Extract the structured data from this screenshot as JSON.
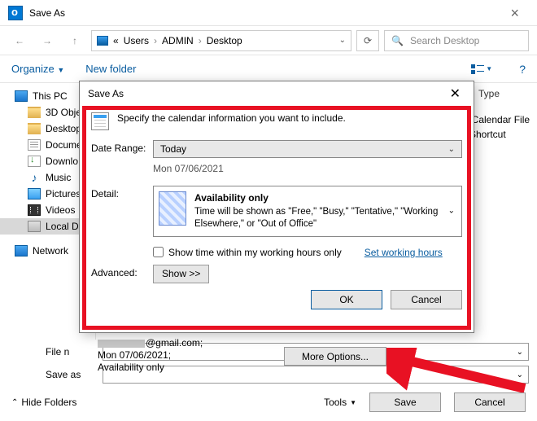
{
  "titlebar": {
    "title": "Save As"
  },
  "nav": {
    "path": [
      "Users",
      "ADMIN",
      "Desktop"
    ],
    "search_placeholder": "Search Desktop"
  },
  "toolbar": {
    "organize": "Organize",
    "newfolder": "New folder"
  },
  "columns": {
    "type": "Type"
  },
  "tree": {
    "thispc": "This PC",
    "items": [
      {
        "label": "3D Obje"
      },
      {
        "label": "Desktop"
      },
      {
        "label": "Docume"
      },
      {
        "label": "Downlo"
      },
      {
        "label": "Music"
      },
      {
        "label": "Pictures"
      },
      {
        "label": "Videos"
      },
      {
        "label": "Local D"
      }
    ],
    "network": "Network"
  },
  "filelist": {
    "rows": [
      {
        "type": "iCalendar File"
      },
      {
        "type": "Shortcut"
      }
    ]
  },
  "bottom": {
    "filename_label": "File n",
    "saveas_label": "Save as"
  },
  "preview": {
    "line1": "@gmail.com;",
    "line2": "Mon 07/06/2021;",
    "line3": "Availability only"
  },
  "moreoptions": "More Options...",
  "footer": {
    "hide": "Hide Folders",
    "tools": "Tools",
    "save": "Save",
    "cancel": "Cancel"
  },
  "dialog": {
    "title": "Save As",
    "intro": "Specify the calendar information you want to include.",
    "daterange_label": "Date Range:",
    "daterange_value": "Today",
    "daterange_sub": "Mon 07/06/2021",
    "detail_label": "Detail:",
    "detail_title": "Availability only",
    "detail_desc": "Time will be shown as \"Free,\" \"Busy,\" \"Tentative,\" \"Working Elsewhere,\" or \"Out of Office\"",
    "chk_label": "Show time within my working hours only",
    "set_hours": "Set working hours",
    "advanced_label": "Advanced:",
    "show_btn": "Show >>",
    "ok": "OK",
    "cancel": "Cancel"
  }
}
